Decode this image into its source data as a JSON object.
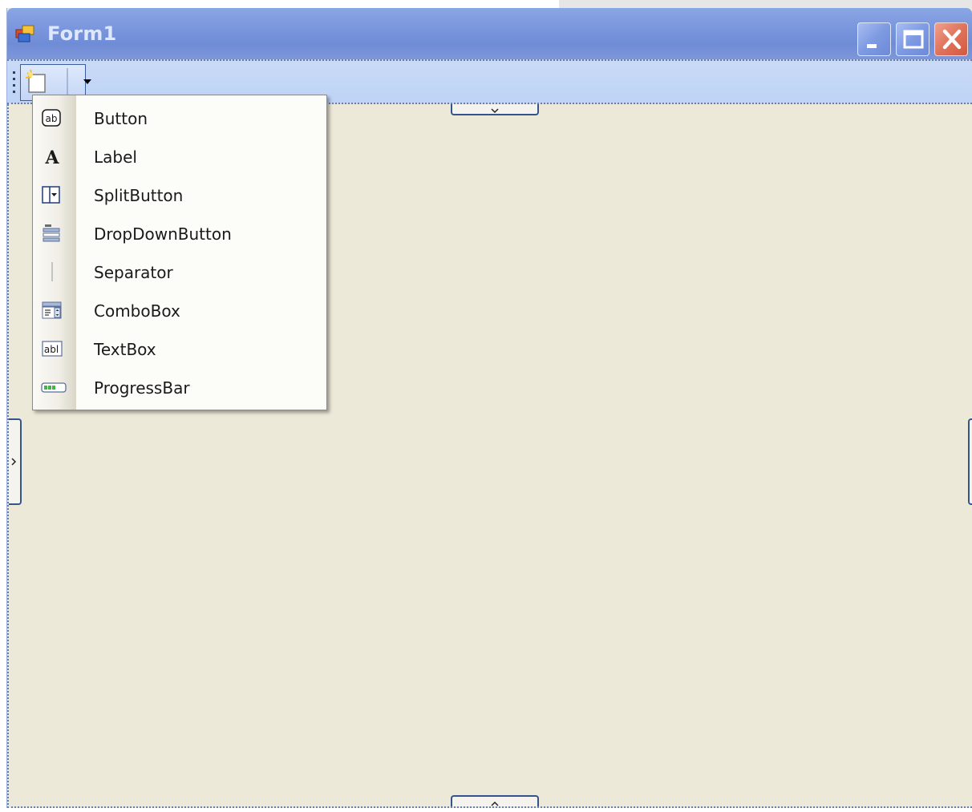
{
  "window": {
    "title": "Form1"
  },
  "menu": {
    "items": [
      {
        "label": "Button",
        "icon": "button-icon"
      },
      {
        "label": "Label",
        "icon": "label-icon"
      },
      {
        "label": "SplitButton",
        "icon": "split-button-icon"
      },
      {
        "label": "DropDownButton",
        "icon": "dropdown-button-icon"
      },
      {
        "label": "Separator",
        "icon": "separator-icon"
      },
      {
        "label": "ComboBox",
        "icon": "combobox-icon"
      },
      {
        "label": "TextBox",
        "icon": "textbox-icon"
      },
      {
        "label": "ProgressBar",
        "icon": "progressbar-icon"
      }
    ]
  },
  "colors": {
    "titlebar": "#7a96dd",
    "toolstrip": "#c4d7f6",
    "surface": "#ece9d8",
    "close": "#d4583d"
  }
}
